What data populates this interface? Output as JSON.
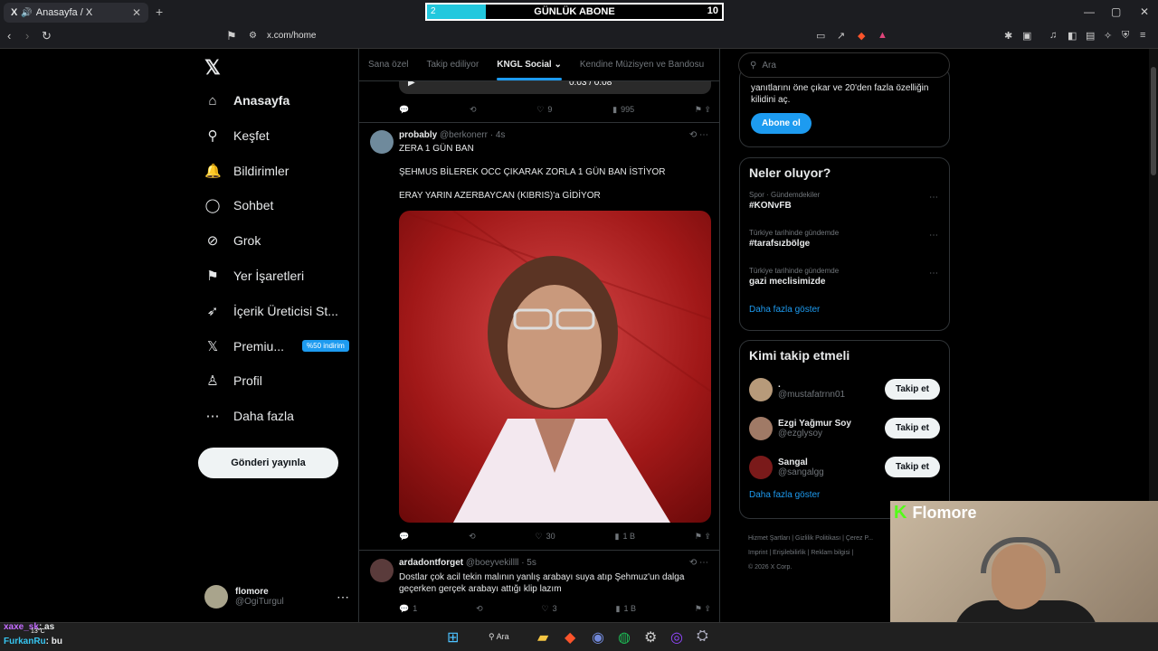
{
  "browser": {
    "tab_title": "Anasayfa / X",
    "tab_close": "✕",
    "new_tab": "+",
    "url": "x.com/home"
  },
  "overlay": {
    "sub_title": "GÜNLÜK ABONE",
    "sub_current": "2",
    "sub_goal": "10",
    "sub_progress": 0.2
  },
  "sidebar": {
    "items": [
      {
        "label": "Anasayfa",
        "icon": "home-icon",
        "glyph": "⌂"
      },
      {
        "label": "Keşfet",
        "icon": "search-icon",
        "glyph": "⚲"
      },
      {
        "label": "Bildirimler",
        "icon": "bell-icon",
        "glyph": "🔔"
      },
      {
        "label": "Sohbet",
        "icon": "chat-icon",
        "glyph": "◯"
      },
      {
        "label": "Grok",
        "icon": "grok-icon",
        "glyph": "⊘"
      },
      {
        "label": "Yer İşaretleri",
        "icon": "bookmark-icon",
        "glyph": "⚑"
      },
      {
        "label": "İçerik Üreticisi St...",
        "icon": "rocket-icon",
        "glyph": "➶"
      },
      {
        "label": "Premiu...",
        "icon": "x-logo-icon",
        "glyph": "𝕏"
      },
      {
        "label": "Profil",
        "icon": "profile-icon",
        "glyph": "♙"
      },
      {
        "label": "Daha fazla",
        "icon": "more-icon",
        "glyph": "⋯"
      }
    ],
    "premium_badge": "%50 indirim",
    "post_button": "Gönderi yayınla",
    "me_name": "flomore",
    "me_handle": "@OgiTurgul"
  },
  "timeline": {
    "tabs": [
      "Sana özel",
      "Takip ediliyor",
      "KNGL Social ⌄",
      "Kendine Müzisyen ve Bandosu"
    ],
    "video_time": "0:03 / 0:08",
    "prev_actions": {
      "likes": "9",
      "views": "995"
    },
    "tweets": [
      {
        "name": "probably",
        "handle": "@berkonerr",
        "time": "· 4s",
        "lines": [
          "ZERA 1 GÜN BAN",
          "",
          "ŞEHMUS BİLEREK OCC ÇIKARAK ZORLA 1 GÜN BAN İSTİYOR",
          "",
          "ERAY YARIN AZERBAYCAN (KIBRIS)'a GİDİYOR"
        ],
        "likes": "30",
        "views": "1 B"
      },
      {
        "name": "ardadontforget",
        "handle": "@boeyvekillll",
        "time": "· 5s",
        "lines": [
          "Dostlar çok acil tekin malının yanlış arabayı suya atıp Şehmuz'un dalga",
          "geçerken gerçek arabayı attığı klip lazım"
        ],
        "replies": "1",
        "likes": "3",
        "views": "1 B"
      }
    ]
  },
  "right": {
    "search_placeholder": "Ara",
    "premium_text": "yanıtlarını öne çıkar ve 20'den fazla özelliğin kilidini aç.",
    "premium_button": "Abone ol",
    "trends_title": "Neler oluyor?",
    "trends": [
      {
        "ctx": "Spor · Gündemdekiler",
        "title": "#KONvFB"
      },
      {
        "ctx": "Türkiye tarihinde gündemde",
        "title": "#tarafsızbölge"
      },
      {
        "ctx": "Türkiye tarihinde gündemde",
        "title": "gazi meclisimizde"
      }
    ],
    "trends_more": "Daha fazla göster",
    "who_title": "Kimi takip etmeli",
    "who": [
      {
        "name": ".",
        "handle": "@mustafatrnn01",
        "button": "Takip et"
      },
      {
        "name": "Ezgi Yağmur Soy",
        "handle": "@ezglysoy",
        "button": "Takip et"
      },
      {
        "name": "Sangal",
        "handle": "@sangalgg",
        "button": "Takip et"
      }
    ],
    "who_more": "Daha fazla göster",
    "footer": [
      "Hizmet Şartları  |  Gizlilik Politikası  |  Çerez P...",
      "Imprint  |  Erişilebilirlik  |  Reklam bilgisi  |",
      "© 2026 X Corp."
    ]
  },
  "stream": {
    "brand": "Flomore",
    "chat": [
      {
        "user": "xaxe_sk",
        "msg": ": as"
      },
      {
        "user": "FurkanRu",
        "msg": ": bu"
      }
    ],
    "weather": "13°C"
  },
  "taskbar": {
    "search": "Ara"
  },
  "colors": {
    "accent": "#1d9bf0",
    "sub_bar": "#22c8de",
    "kick_green": "#53fc18"
  }
}
